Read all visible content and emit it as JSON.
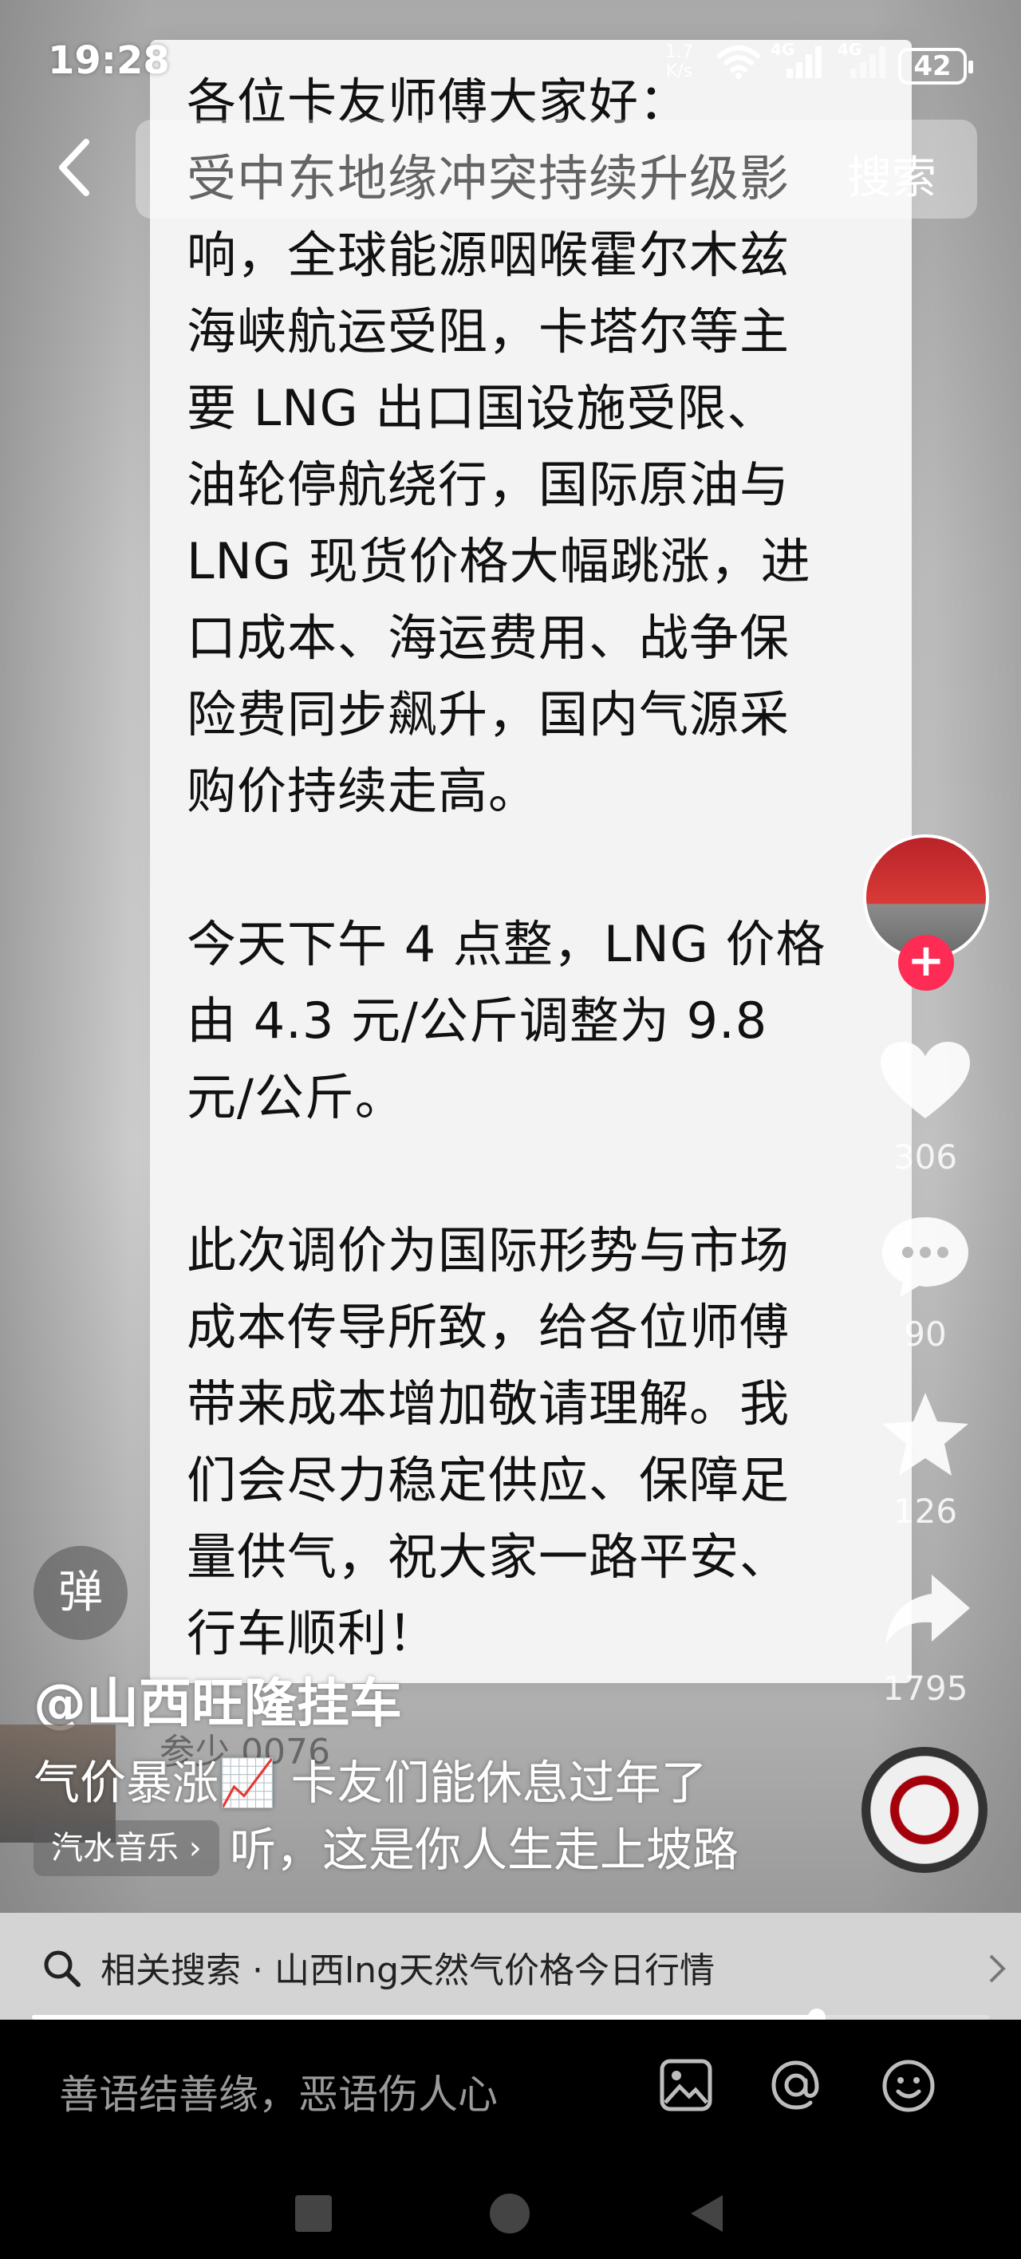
{
  "status_bar": {
    "time": "19:28",
    "net_speed_value": "1.7",
    "net_speed_unit": "K/s",
    "network_1": "4G",
    "network_2": "4G",
    "battery": "42"
  },
  "header": {
    "search_label": "搜索"
  },
  "message": {
    "text": "各位卡友师傅大家好：\n受中东地缘冲突持续升级影\n响，全球能源咽喉霍尔木兹\n海峡航运受阻，卡塔尔等主\n要 LNG 出口国设施受限、\n油轮停航绕行，国际原油与\nLNG 现货价格大幅跳涨，进\n口成本、海运费用、战争保\n险费同步飙升，国内气源采\n购价持续走高。\n\n今天下午 4 点整，LNG 价格\n由 4.3 元/公斤调整为 9.8\n元/公斤。\n\n此次调价为国际形势与市场\n成本传导所致，给各位师傅\n带来成本增加敬请理解。我\n们会尽力稳定供应、保障足\n量供气，祝大家一路平安、\n行车顺利！",
    "footer": "参少 0076"
  },
  "rail": {
    "likes": "306",
    "comments": "90",
    "favorites": "126",
    "shares": "1795"
  },
  "overlay": {
    "danmu_label": "弹",
    "author": "@山西旺隆挂车",
    "caption_line1": "气价暴涨📈   卡友们能休息过年了",
    "caption_line2": "听，这是你人生走上坡路",
    "music_label": "汽水音乐 ›"
  },
  "related": {
    "text": "相关搜索 · 山西lng天然气价格今日行情"
  },
  "progress": {
    "fraction": 0.82
  },
  "comment": {
    "placeholder": "善语结善缘，恶语伤人心"
  },
  "icons": [
    "back-arrow-icon",
    "wifi-icon",
    "signal-icon",
    "heart-icon",
    "comment-bubble-icon",
    "star-icon",
    "share-arrow-icon",
    "search-icon",
    "image-icon",
    "at-icon",
    "emoji-icon",
    "nav-square-icon",
    "nav-circle-icon",
    "nav-triangle-icon"
  ]
}
